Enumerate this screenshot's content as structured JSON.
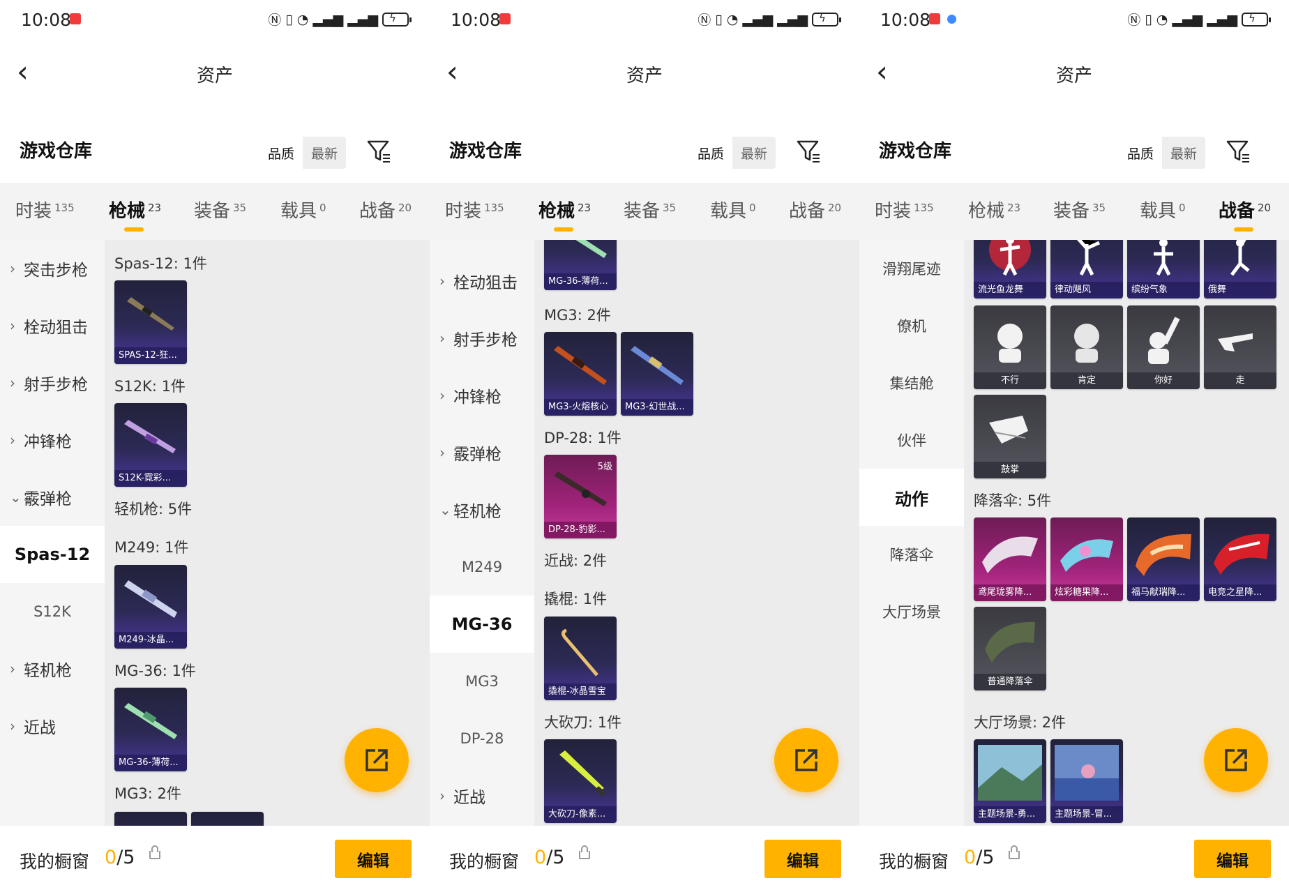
{
  "status": {
    "time": "10:08"
  },
  "nav": {
    "back": "‹",
    "title": "资产"
  },
  "section": {
    "title": "游戏仓库",
    "sort_quality": "品质",
    "sort_newest": "最新"
  },
  "tabs": [
    {
      "label": "时装",
      "count": "135"
    },
    {
      "label": "枪械",
      "count": "23"
    },
    {
      "label": "装备",
      "count": "35"
    },
    {
      "label": "载具",
      "count": "0"
    },
    {
      "label": "战备",
      "count": "20"
    }
  ],
  "panel1": {
    "side": [
      "突击步枪",
      "栓动狙击",
      "射手步枪",
      "冲锋枪",
      "霰弹枪",
      "Spas-12",
      "S12K",
      "轻机枪",
      "近战"
    ],
    "groups": [
      "Spas-12: 1件",
      "S12K: 1件",
      "轻机枪: 5件",
      "M249: 1件",
      "MG-36: 1件",
      "MG3: 2件"
    ],
    "cards": [
      "SPAS-12-狂...",
      "S12K-霓彩...",
      "M249-冰晶...",
      "MG-36-薄荷..."
    ]
  },
  "panel2": {
    "side": [
      "栓动狙击",
      "射手步枪",
      "冲锋枪",
      "霰弹枪",
      "轻机枪",
      "M249",
      "MG-36",
      "MG3",
      "DP-28",
      "近战"
    ],
    "groups": [
      "MG3: 2件",
      "DP-28: 1件",
      "近战: 2件",
      "撬棍: 1件",
      "大砍刀: 1件"
    ],
    "cards": [
      "MG-36-薄荷...",
      "MG3-火熔核心",
      "MG3-幻世战...",
      "DP-28-豹影...",
      "撬棍-冰晶雪宝",
      "大砍刀-像素..."
    ],
    "level": "5级"
  },
  "panel3": {
    "side": [
      "滑翔尾迹",
      "僚机",
      "集结舱",
      "伙伴",
      "动作",
      "降落伞",
      "大厅场景"
    ],
    "groups": [
      "降落伞: 5件",
      "大厅场景: 2件"
    ],
    "emotes": [
      "流光鱼龙舞",
      "律动飓风",
      "缤纷气象",
      "俄舞",
      "不行",
      "肯定",
      "你好",
      "走",
      "鼓掌"
    ],
    "chutes": [
      "鸢尾珑雾降...",
      "炫彩糖果降...",
      "福马献瑞降...",
      "电竞之星降...",
      "普通降落伞"
    ],
    "scenes": [
      "主题场景-勇...",
      "主题场景-冒..."
    ]
  },
  "bottom": {
    "label": "我的橱窗",
    "count_current": "0",
    "count_total": "/5",
    "edit": "编辑"
  },
  "colors": {
    "accent": "#ffb300",
    "card_purple": "#2c2a55",
    "card_pink": "#a0237a"
  }
}
